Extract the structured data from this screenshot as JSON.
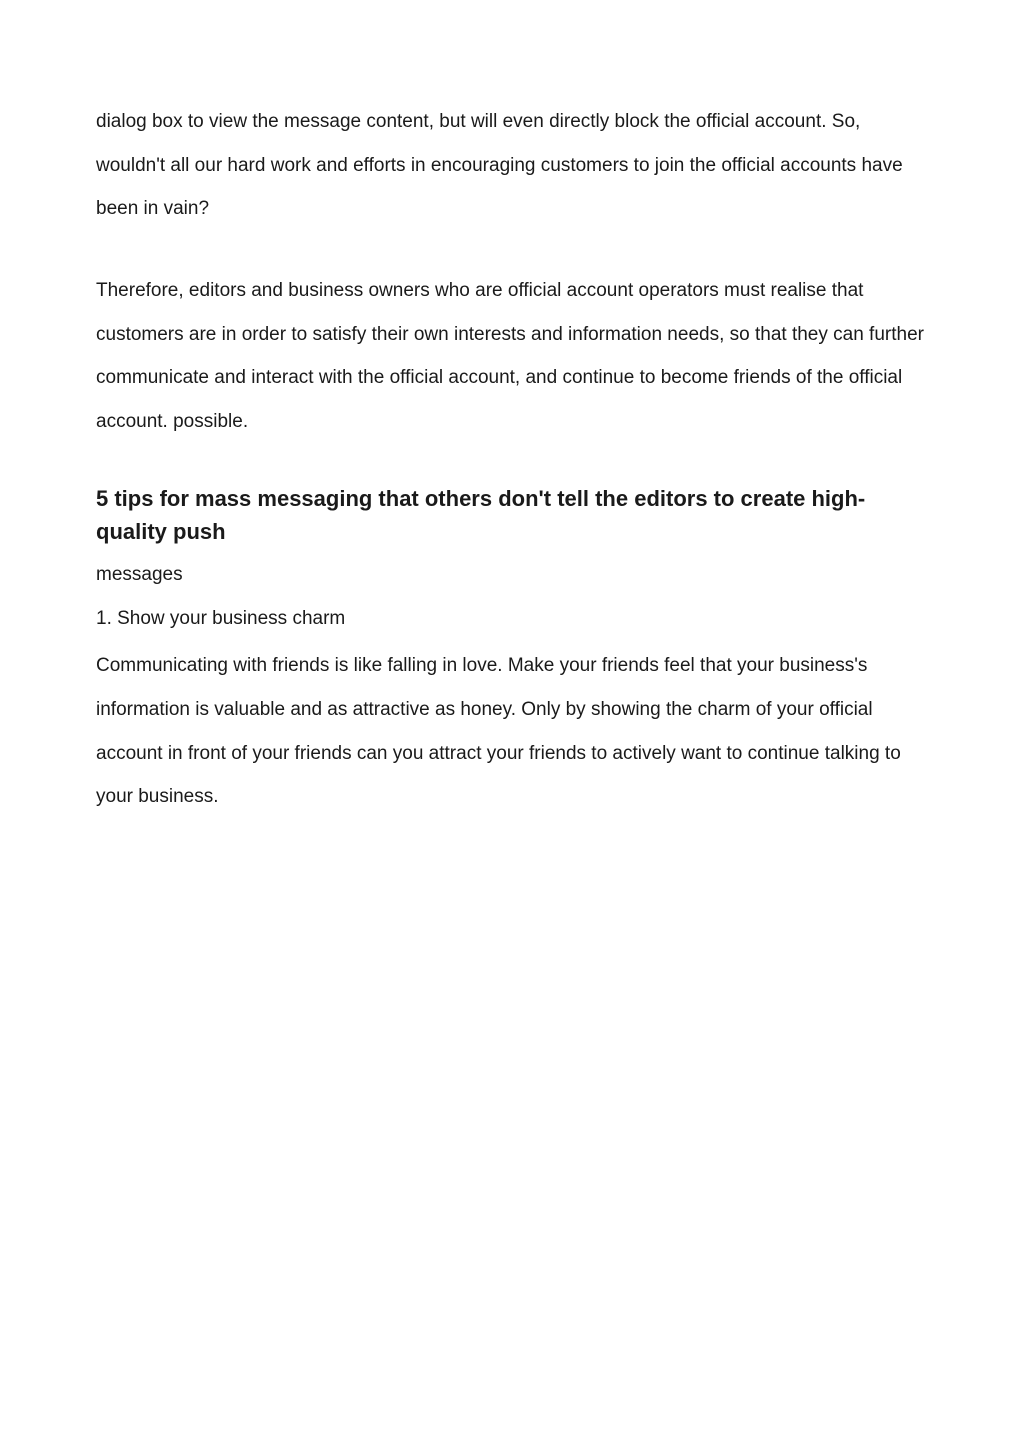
{
  "paragraph1": "dialog box to view the message content, but will even directly block the official account. So, wouldn't all our hard work and efforts in encouraging customers to join the official accounts have been in vain?",
  "paragraph2": "Therefore, editors and business owners who are official account operators must realise that customers are in order to satisfy their own interests and information needs, so that they can further communicate and interact with the official account, and continue to become friends of the official account. possible.",
  "heading": "5 tips for mass messaging that others don't tell the editors to create high-quality push",
  "subtext": "messages",
  "listItem1": "1. Show your business charm",
  "bodyText": "Communicating with friends is like falling in love. Make your friends feel that your business's information is valuable and as attractive as honey. Only by showing the charm of your official account in front of your friends can you attract your friends to actively want to continue talking to your business."
}
